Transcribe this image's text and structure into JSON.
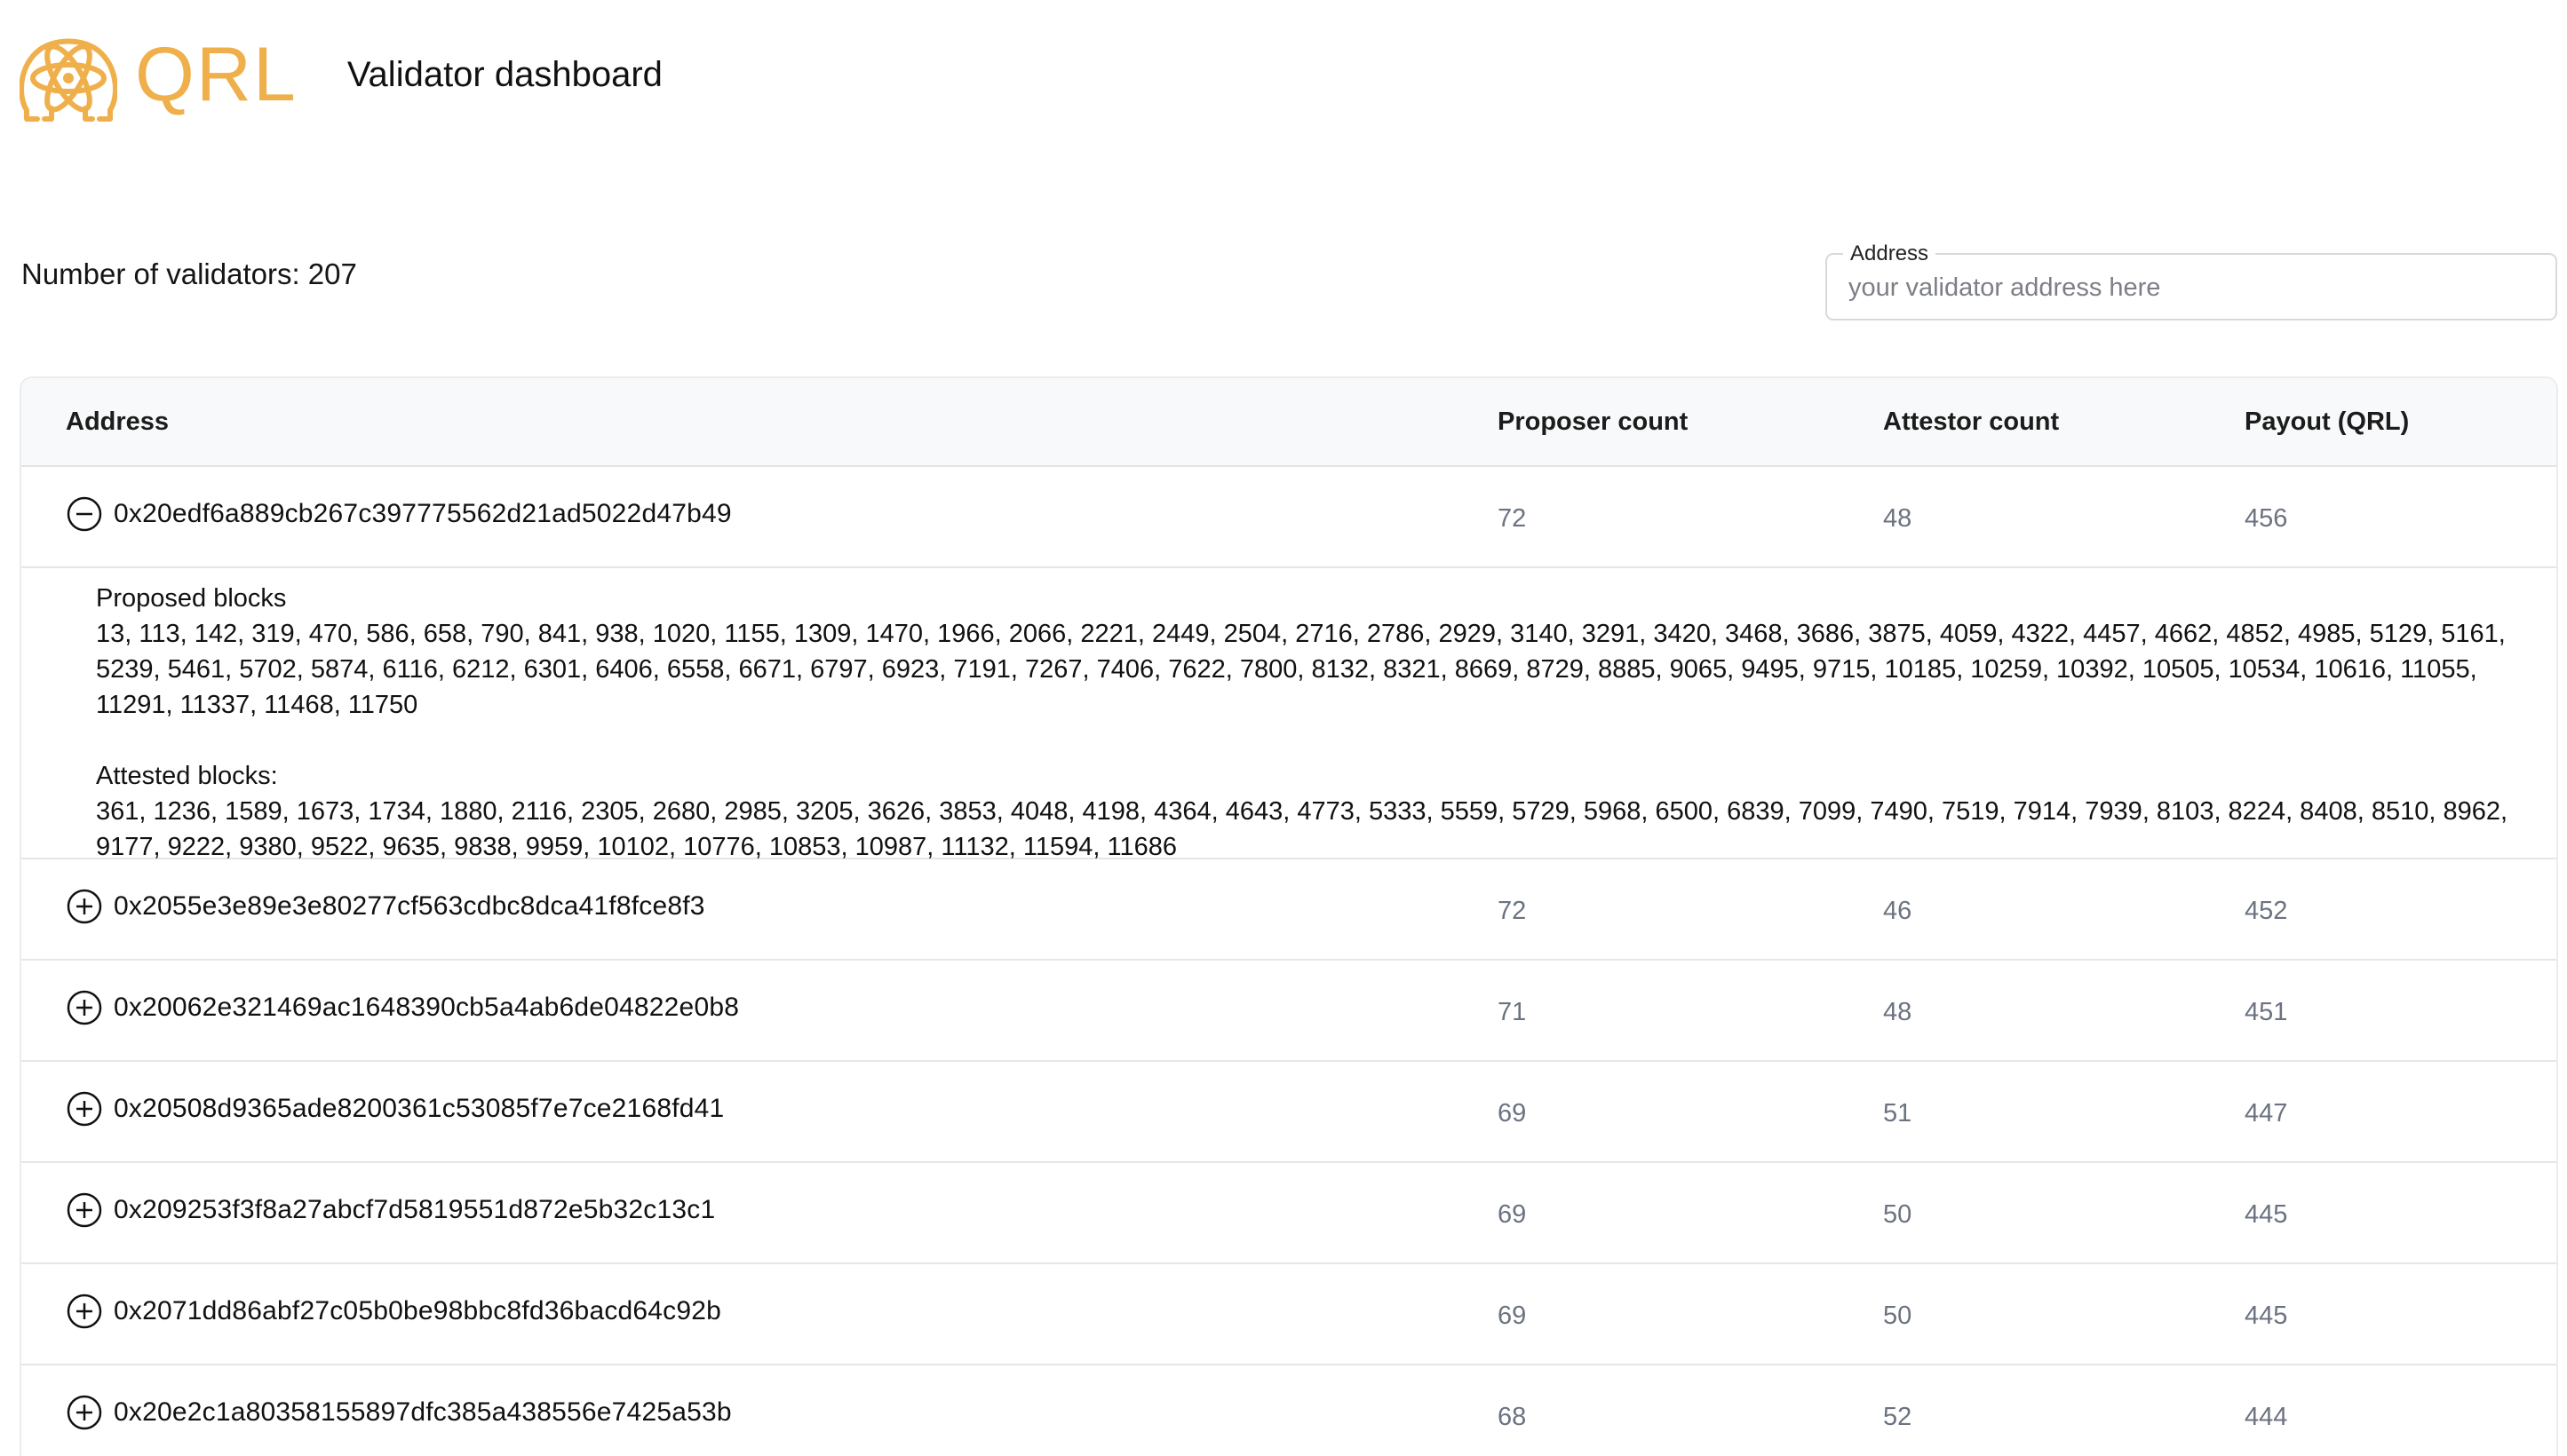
{
  "header": {
    "logo_text": "QRL",
    "title": "Validator dashboard",
    "brand_color": "#efb04c"
  },
  "summary": {
    "validator_count_text": "Number of validators: 207"
  },
  "search": {
    "label": "Address",
    "placeholder": "your validator address here",
    "value": ""
  },
  "table": {
    "headers": {
      "address": "Address",
      "proposer": "Proposer count",
      "attestor": "Attestor count",
      "payout": "Payout (QRL)"
    },
    "rows": [
      {
        "address": "0x20edf6a889cb267c397775562d21ad5022d47b49",
        "proposer": "72",
        "attestor": "48",
        "payout": "456",
        "expanded": true,
        "toggle_icon": "minus-circle-icon",
        "proposed_label": "Proposed blocks",
        "proposed_blocks": "13, 113, 142, 319, 470, 586, 658, 790, 841, 938, 1020, 1155, 1309, 1470, 1966, 2066, 2221, 2449, 2504, 2716, 2786, 2929, 3140, 3291, 3420, 3468, 3686, 3875, 4059, 4322, 4457, 4662, 4852, 4985, 5129, 5161, 5239, 5461, 5702, 5874, 6116, 6212, 6301, 6406, 6558, 6671, 6797, 6923, 7191, 7267, 7406, 7622, 7800, 8132, 8321, 8669, 8729, 8885, 9065, 9495, 9715, 10185, 10259, 10392, 10505, 10534, 10616, 11055, 11291, 11337, 11468, 11750",
        "attested_label": "Attested blocks:",
        "attested_blocks": "361, 1236, 1589, 1673, 1734, 1880, 2116, 2305, 2680, 2985, 3205, 3626, 3853, 4048, 4198, 4364, 4643, 4773, 5333, 5559, 5729, 5968, 6500, 6839, 7099, 7490, 7519, 7914, 7939, 8103, 8224, 8408, 8510, 8962, 9177, 9222, 9380, 9522, 9635, 9838, 9959, 10102, 10776, 10853, 10987, 11132, 11594, 11686"
      },
      {
        "address": "0x2055e3e89e3e80277cf563cdbc8dca41f8fce8f3",
        "proposer": "72",
        "attestor": "46",
        "payout": "452",
        "toggle_icon": "plus-circle-icon"
      },
      {
        "address": "0x20062e321469ac1648390cb5a4ab6de04822e0b8",
        "proposer": "71",
        "attestor": "48",
        "payout": "451",
        "toggle_icon": "plus-circle-icon"
      },
      {
        "address": "0x20508d9365ade8200361c53085f7e7ce2168fd41",
        "proposer": "69",
        "attestor": "51",
        "payout": "447",
        "toggle_icon": "plus-circle-icon"
      },
      {
        "address": "0x209253f3f8a27abcf7d5819551d872e5b32c13c1",
        "proposer": "69",
        "attestor": "50",
        "payout": "445",
        "toggle_icon": "plus-circle-icon"
      },
      {
        "address": "0x2071dd86abf27c05b0be98bbc8fd36bacd64c92b",
        "proposer": "69",
        "attestor": "50",
        "payout": "445",
        "toggle_icon": "plus-circle-icon"
      },
      {
        "address": "0x20e2c1a80358155897dfc385a438556e7425a53b",
        "proposer": "68",
        "attestor": "52",
        "payout": "444",
        "toggle_icon": "plus-circle-icon"
      }
    ]
  }
}
